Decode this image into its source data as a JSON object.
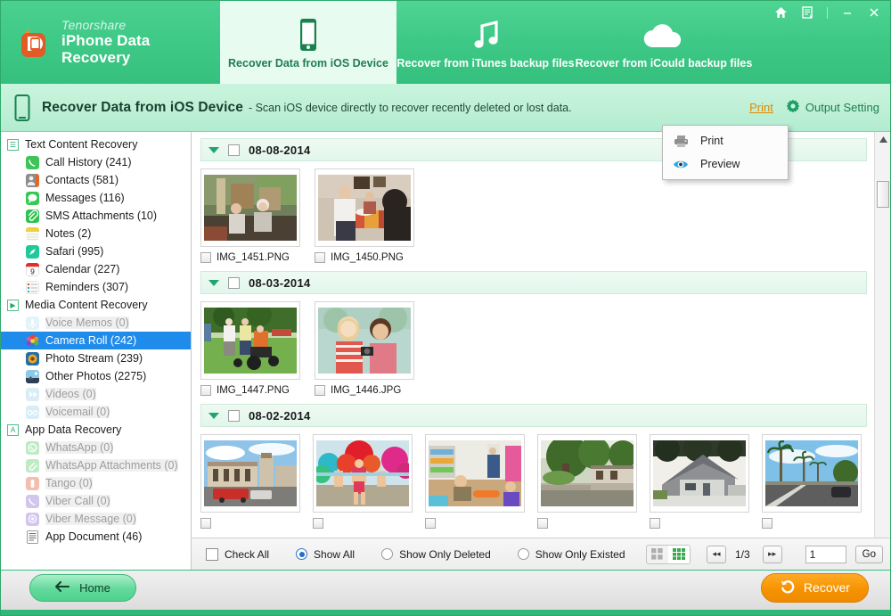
{
  "window": {
    "brand_sub": "Tenorshare",
    "brand_title": "iPhone Data Recovery",
    "controls": [
      {
        "name": "home-icon",
        "label": "Home"
      },
      {
        "name": "register-icon",
        "label": "Register"
      },
      {
        "name": "minimize-icon",
        "label": "Minimize"
      },
      {
        "name": "close-icon",
        "label": "Close"
      }
    ]
  },
  "tabs": [
    {
      "label": "Recover Data from iOS Device",
      "icon": "phone-icon",
      "active": true
    },
    {
      "label": "Recover from iTunes backup files",
      "icon": "music-note-icon",
      "active": false
    },
    {
      "label": "Recover from iCould backup files",
      "icon": "cloud-icon",
      "active": false
    }
  ],
  "subheader": {
    "title": "Recover Data from iOS Device",
    "description": "- Scan iOS device directly to recover recently deleted or lost data.",
    "print_label": "Print",
    "output_setting_label": "Output Setting"
  },
  "print_menu": {
    "open": true,
    "items": [
      {
        "label": "Print",
        "icon": "printer-icon"
      },
      {
        "label": "Preview",
        "icon": "eye-icon"
      }
    ]
  },
  "sidebar": {
    "groups": [
      {
        "label": "Text Content Recovery",
        "icon": "list-icon",
        "expanded": true,
        "items": [
          {
            "label": "Call History (241)",
            "icon": "phone-call-icon",
            "color": "#3fc45a",
            "enabled": true,
            "selected": false
          },
          {
            "label": "Contacts (581)",
            "icon": "contacts-icon",
            "color": "#8d8d8d",
            "enabled": true,
            "selected": false
          },
          {
            "label": "Messages (116)",
            "icon": "messages-icon",
            "color": "#36c755",
            "enabled": true,
            "selected": false
          },
          {
            "label": "SMS Attachments (10)",
            "icon": "paperclip-icon",
            "color": "#2fc24f",
            "enabled": true,
            "selected": false
          },
          {
            "label": "Notes (2)",
            "icon": "notes-icon",
            "color": "#f3d24a",
            "enabled": true,
            "selected": false
          },
          {
            "label": "Safari (995)",
            "icon": "safari-icon",
            "color": "#1fc99a",
            "enabled": true,
            "selected": false
          },
          {
            "label": "Calendar (227)",
            "icon": "calendar-icon",
            "color": "#ffffff",
            "enabled": true,
            "selected": false
          },
          {
            "label": "Reminders (307)",
            "icon": "reminders-icon",
            "color": "#fafafa",
            "enabled": true,
            "selected": false
          }
        ]
      },
      {
        "label": "Media Content Recovery",
        "icon": "play-icon",
        "expanded": true,
        "items": [
          {
            "label": "Voice Memos (0)",
            "icon": "microphone-icon",
            "color": "#bfe6f5",
            "enabled": false,
            "selected": false
          },
          {
            "label": "Camera Roll (242)",
            "icon": "camera-roll-icon",
            "color": "#e85d3a",
            "enabled": true,
            "selected": true
          },
          {
            "label": "Photo Stream (239)",
            "icon": "photo-stream-icon",
            "color": "#f0a62a",
            "enabled": true,
            "selected": false
          },
          {
            "label": "Other Photos (2275)",
            "icon": "other-photos-icon",
            "color": "#4f8fd0",
            "enabled": true,
            "selected": false
          },
          {
            "label": "Videos (0)",
            "icon": "video-icon",
            "color": "#a9d8ef",
            "enabled": false,
            "selected": false
          },
          {
            "label": "Voicemail (0)",
            "icon": "voicemail-icon",
            "color": "#a9d8ef",
            "enabled": false,
            "selected": false
          }
        ]
      },
      {
        "label": "App Data Recovery",
        "icon": "app-icon",
        "expanded": true,
        "items": [
          {
            "label": "WhatsApp (0)",
            "icon": "whatsapp-icon",
            "color": "#9fe0a8",
            "enabled": false,
            "selected": false
          },
          {
            "label": "WhatsApp Attachments (0)",
            "icon": "whatsapp-attachments-icon",
            "color": "#9fe0a8",
            "enabled": false,
            "selected": false
          },
          {
            "label": "Tango (0)",
            "icon": "tango-icon",
            "color": "#f0a08a",
            "enabled": false,
            "selected": false
          },
          {
            "label": "Viber Call (0)",
            "icon": "viber-call-icon",
            "color": "#c3b6e8",
            "enabled": false,
            "selected": false
          },
          {
            "label": "Viber Message (0)",
            "icon": "viber-message-icon",
            "color": "#c3b6e8",
            "enabled": false,
            "selected": false
          },
          {
            "label": "App Document (46)",
            "icon": "document-icon",
            "color": "#f7f7f7",
            "enabled": true,
            "selected": false
          }
        ]
      }
    ]
  },
  "content": {
    "date_groups": [
      {
        "date": "08-08-2014",
        "checked": false,
        "expanded": true,
        "files": [
          {
            "name": "IMG_1451.PNG",
            "checked": false,
            "thumb": "elderly-couple-porch"
          },
          {
            "name": "IMG_1450.PNG",
            "checked": false,
            "thumb": "family-dinner-table"
          }
        ]
      },
      {
        "date": "08-03-2014",
        "checked": false,
        "expanded": true,
        "files": [
          {
            "name": "IMG_1447.PNG",
            "checked": false,
            "thumb": "family-stroller-park"
          },
          {
            "name": "IMG_1446.JPG",
            "checked": false,
            "thumb": "two-girls-camera"
          }
        ]
      },
      {
        "date": "08-02-2014",
        "checked": false,
        "expanded": true,
        "files": [
          {
            "name": "",
            "checked": false,
            "thumb": "colonial-building-street"
          },
          {
            "name": "",
            "checked": false,
            "thumb": "carnival-dancers"
          },
          {
            "name": "",
            "checked": false,
            "thumb": "kids-playroom"
          },
          {
            "name": "",
            "checked": false,
            "thumb": "house-with-tree"
          },
          {
            "name": "",
            "checked": false,
            "thumb": "grey-house-roof"
          },
          {
            "name": "",
            "checked": false,
            "thumb": "palm-tree-road"
          }
        ]
      }
    ]
  },
  "toolbar": {
    "check_all_label": "Check All",
    "check_all_checked": false,
    "filters": [
      {
        "label": "Show All",
        "selected": true
      },
      {
        "label": "Show Only Deleted",
        "selected": false
      },
      {
        "label": "Show Only Existed",
        "selected": false
      }
    ],
    "view_modes": [
      {
        "name": "list-view-icon",
        "active": false
      },
      {
        "name": "grid-view-icon",
        "active": true
      }
    ],
    "prev_label": "◂◂",
    "next_label": "▸▸",
    "page_indicator": "1/3",
    "page_input_value": "1",
    "go_label": "Go"
  },
  "footer": {
    "home_label": "Home",
    "recover_label": "Recover"
  },
  "colors": {
    "brand_green": "#3fc987",
    "accent_orange": "#f79300",
    "selection_blue": "#1f8cec",
    "print_link": "#e08a00"
  }
}
